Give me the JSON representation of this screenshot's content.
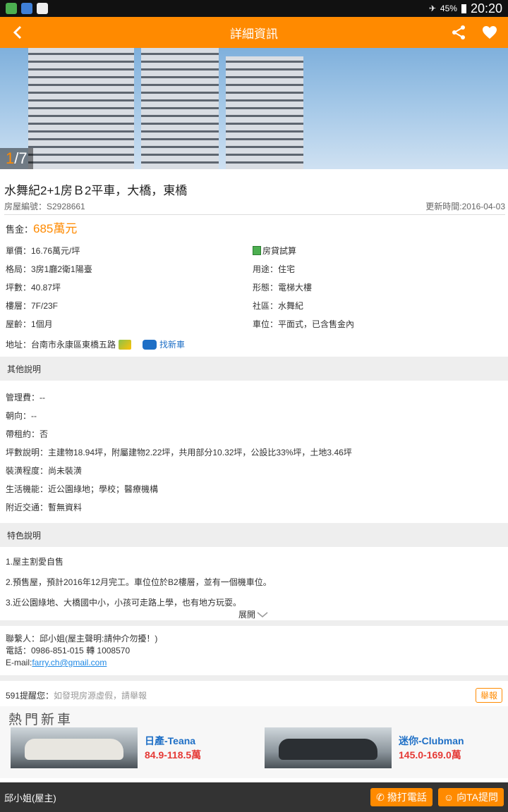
{
  "status_bar": {
    "battery": "45%",
    "time": "20:20"
  },
  "app_bar": {
    "title": "詳細資訊"
  },
  "gallery": {
    "current": "1",
    "total": "/7"
  },
  "property": {
    "title": "水舞紀2+1房Ｂ2平車，大橋，東橋",
    "id_label": "房屋編號：S2928661",
    "updated": "更新時間:2016-04-03",
    "price_label": "售金：",
    "price_value": "685萬元",
    "details": [
      {
        "left": "單價：16.76萬元/坪",
        "right": "房貸試算"
      },
      {
        "left": "格局：3房1廳2衛1陽臺",
        "right": "用途：住宅"
      },
      {
        "left": "坪數：40.87坪",
        "right": "形態：電梯大樓"
      },
      {
        "left": "樓層：7F/23F",
        "right": "社區：水舞紀"
      },
      {
        "left": "屋齡：1個月",
        "right": "車位：平面式，已含售金內"
      }
    ],
    "address": "地址：台南市永康區東橋五路",
    "find_car": "找新車"
  },
  "other": {
    "heading": "其他說明",
    "lines": [
      "管理費：--",
      "朝向：--",
      "帶租約：否",
      "坪數說明：主建物18.94坪，附屬建物2.22坪，共用部分10.32坪，公設比33%坪，土地3.46坪",
      "裝潢程度：尚未裝潢",
      "生活機能：近公園綠地；學校；醫療機構",
      "附近交通：暫無資料"
    ]
  },
  "features": {
    "heading": "特色說明",
    "lines": [
      "1.屋主割愛自售",
      "2.預售屋，預計2016年12月完工。車位位於B2樓層，並有一個機車位。",
      "3.近公園綠地、大橋國中小，小孩可走路上學，也有地方玩耍。"
    ],
    "expand": "展開"
  },
  "contact": {
    "person": "聯繫人：邱小姐(屋主聲明:請仲介勿擾！)",
    "phone": "電話：0986-851-015 轉 1008570",
    "email_label": "E-mail:",
    "email": "farry.ch@gmail.com"
  },
  "warning": {
    "prefix": "591提醒您：",
    "text": "如發現房源虛假，請舉報",
    "report": "舉報"
  },
  "ad": {
    "heading": "熱門新車",
    "cars": [
      {
        "name": "日產-Teana",
        "price": "84.9-118.5萬",
        "color": "#e8e6e0"
      },
      {
        "name": "迷你-Clubman",
        "price": "145.0-169.0萬",
        "color": "#2b2f33"
      }
    ]
  },
  "bottom": {
    "owner": "邱小姐(屋主)",
    "call": "撥打電話",
    "ask": "向TA提問"
  }
}
